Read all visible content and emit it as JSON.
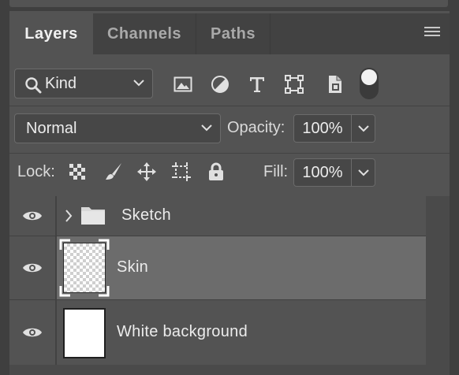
{
  "tabs": [
    {
      "label": "Layers",
      "active": true
    },
    {
      "label": "Channels",
      "active": false
    },
    {
      "label": "Paths",
      "active": false
    }
  ],
  "filter": {
    "kind_label": "Kind",
    "icons": [
      "image-filter-icon",
      "adjustment-filter-icon",
      "type-filter-icon",
      "shape-filter-icon",
      "smart-object-filter-icon",
      "filter-toggle-icon"
    ]
  },
  "blend": {
    "mode": "Normal",
    "opacity_label": "Opacity:",
    "opacity_value": "100%"
  },
  "lock": {
    "label": "Lock:",
    "fill_label": "Fill:",
    "fill_value": "100%"
  },
  "layers": [
    {
      "name": "Sketch",
      "type": "group",
      "visible": true,
      "selected": false
    },
    {
      "name": "Skin",
      "type": "pixel",
      "visible": true,
      "selected": true
    },
    {
      "name": "White background",
      "type": "pixel",
      "visible": true,
      "selected": false
    }
  ],
  "colors": {
    "panel_bg": "#535353",
    "tab_bar_bg": "#424242",
    "selected_row": "#6c6c6c",
    "text": "#ececec"
  }
}
